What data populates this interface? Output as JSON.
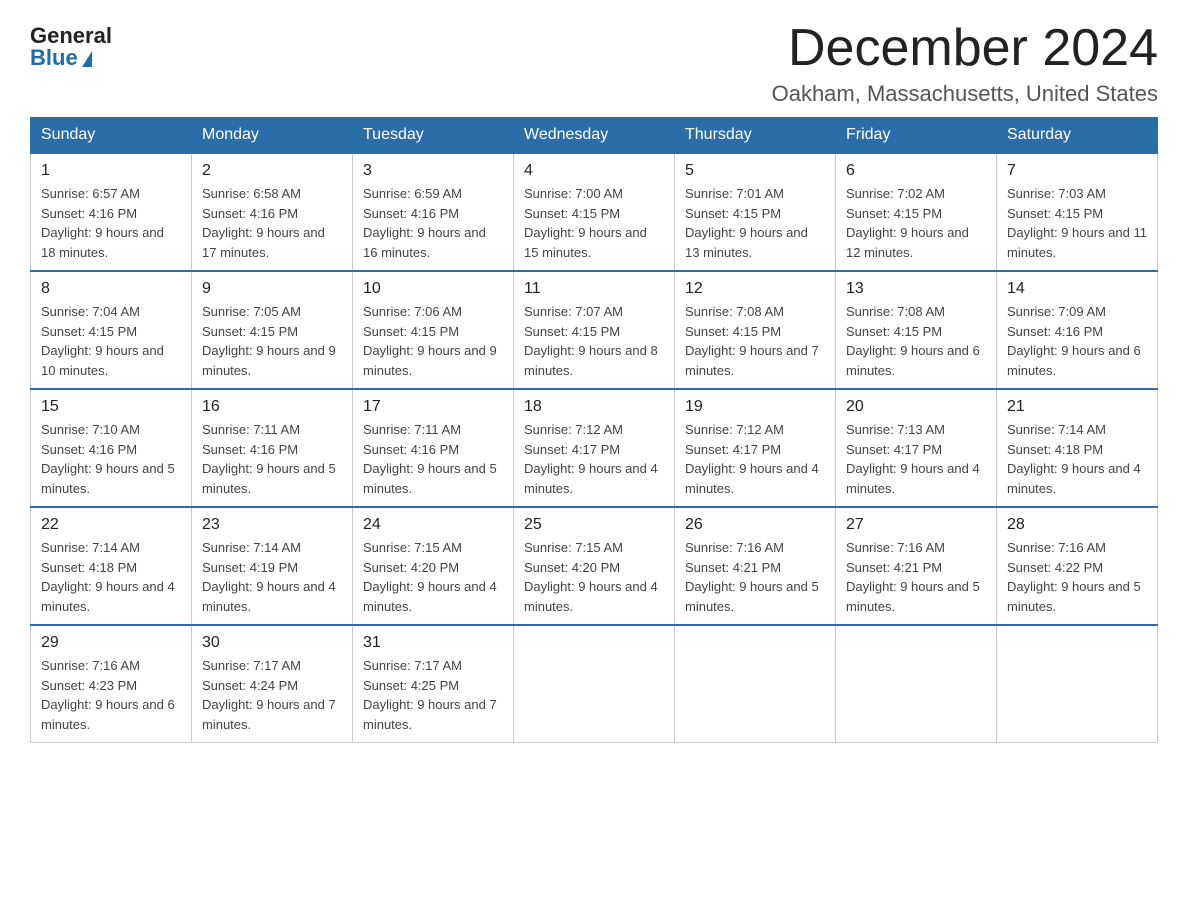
{
  "header": {
    "logo_general": "General",
    "logo_blue": "Blue",
    "month_title": "December 2024",
    "location": "Oakham, Massachusetts, United States"
  },
  "weekdays": [
    "Sunday",
    "Monday",
    "Tuesday",
    "Wednesday",
    "Thursday",
    "Friday",
    "Saturday"
  ],
  "weeks": [
    [
      {
        "day": "1",
        "sunrise": "6:57 AM",
        "sunset": "4:16 PM",
        "daylight": "9 hours and 18 minutes."
      },
      {
        "day": "2",
        "sunrise": "6:58 AM",
        "sunset": "4:16 PM",
        "daylight": "9 hours and 17 minutes."
      },
      {
        "day": "3",
        "sunrise": "6:59 AM",
        "sunset": "4:16 PM",
        "daylight": "9 hours and 16 minutes."
      },
      {
        "day": "4",
        "sunrise": "7:00 AM",
        "sunset": "4:15 PM",
        "daylight": "9 hours and 15 minutes."
      },
      {
        "day": "5",
        "sunrise": "7:01 AM",
        "sunset": "4:15 PM",
        "daylight": "9 hours and 13 minutes."
      },
      {
        "day": "6",
        "sunrise": "7:02 AM",
        "sunset": "4:15 PM",
        "daylight": "9 hours and 12 minutes."
      },
      {
        "day": "7",
        "sunrise": "7:03 AM",
        "sunset": "4:15 PM",
        "daylight": "9 hours and 11 minutes."
      }
    ],
    [
      {
        "day": "8",
        "sunrise": "7:04 AM",
        "sunset": "4:15 PM",
        "daylight": "9 hours and 10 minutes."
      },
      {
        "day": "9",
        "sunrise": "7:05 AM",
        "sunset": "4:15 PM",
        "daylight": "9 hours and 9 minutes."
      },
      {
        "day": "10",
        "sunrise": "7:06 AM",
        "sunset": "4:15 PM",
        "daylight": "9 hours and 9 minutes."
      },
      {
        "day": "11",
        "sunrise": "7:07 AM",
        "sunset": "4:15 PM",
        "daylight": "9 hours and 8 minutes."
      },
      {
        "day": "12",
        "sunrise": "7:08 AM",
        "sunset": "4:15 PM",
        "daylight": "9 hours and 7 minutes."
      },
      {
        "day": "13",
        "sunrise": "7:08 AM",
        "sunset": "4:15 PM",
        "daylight": "9 hours and 6 minutes."
      },
      {
        "day": "14",
        "sunrise": "7:09 AM",
        "sunset": "4:16 PM",
        "daylight": "9 hours and 6 minutes."
      }
    ],
    [
      {
        "day": "15",
        "sunrise": "7:10 AM",
        "sunset": "4:16 PM",
        "daylight": "9 hours and 5 minutes."
      },
      {
        "day": "16",
        "sunrise": "7:11 AM",
        "sunset": "4:16 PM",
        "daylight": "9 hours and 5 minutes."
      },
      {
        "day": "17",
        "sunrise": "7:11 AM",
        "sunset": "4:16 PM",
        "daylight": "9 hours and 5 minutes."
      },
      {
        "day": "18",
        "sunrise": "7:12 AM",
        "sunset": "4:17 PM",
        "daylight": "9 hours and 4 minutes."
      },
      {
        "day": "19",
        "sunrise": "7:12 AM",
        "sunset": "4:17 PM",
        "daylight": "9 hours and 4 minutes."
      },
      {
        "day": "20",
        "sunrise": "7:13 AM",
        "sunset": "4:17 PM",
        "daylight": "9 hours and 4 minutes."
      },
      {
        "day": "21",
        "sunrise": "7:14 AM",
        "sunset": "4:18 PM",
        "daylight": "9 hours and 4 minutes."
      }
    ],
    [
      {
        "day": "22",
        "sunrise": "7:14 AM",
        "sunset": "4:18 PM",
        "daylight": "9 hours and 4 minutes."
      },
      {
        "day": "23",
        "sunrise": "7:14 AM",
        "sunset": "4:19 PM",
        "daylight": "9 hours and 4 minutes."
      },
      {
        "day": "24",
        "sunrise": "7:15 AM",
        "sunset": "4:20 PM",
        "daylight": "9 hours and 4 minutes."
      },
      {
        "day": "25",
        "sunrise": "7:15 AM",
        "sunset": "4:20 PM",
        "daylight": "9 hours and 4 minutes."
      },
      {
        "day": "26",
        "sunrise": "7:16 AM",
        "sunset": "4:21 PM",
        "daylight": "9 hours and 5 minutes."
      },
      {
        "day": "27",
        "sunrise": "7:16 AM",
        "sunset": "4:21 PM",
        "daylight": "9 hours and 5 minutes."
      },
      {
        "day": "28",
        "sunrise": "7:16 AM",
        "sunset": "4:22 PM",
        "daylight": "9 hours and 5 minutes."
      }
    ],
    [
      {
        "day": "29",
        "sunrise": "7:16 AM",
        "sunset": "4:23 PM",
        "daylight": "9 hours and 6 minutes."
      },
      {
        "day": "30",
        "sunrise": "7:17 AM",
        "sunset": "4:24 PM",
        "daylight": "9 hours and 7 minutes."
      },
      {
        "day": "31",
        "sunrise": "7:17 AM",
        "sunset": "4:25 PM",
        "daylight": "9 hours and 7 minutes."
      },
      null,
      null,
      null,
      null
    ]
  ]
}
